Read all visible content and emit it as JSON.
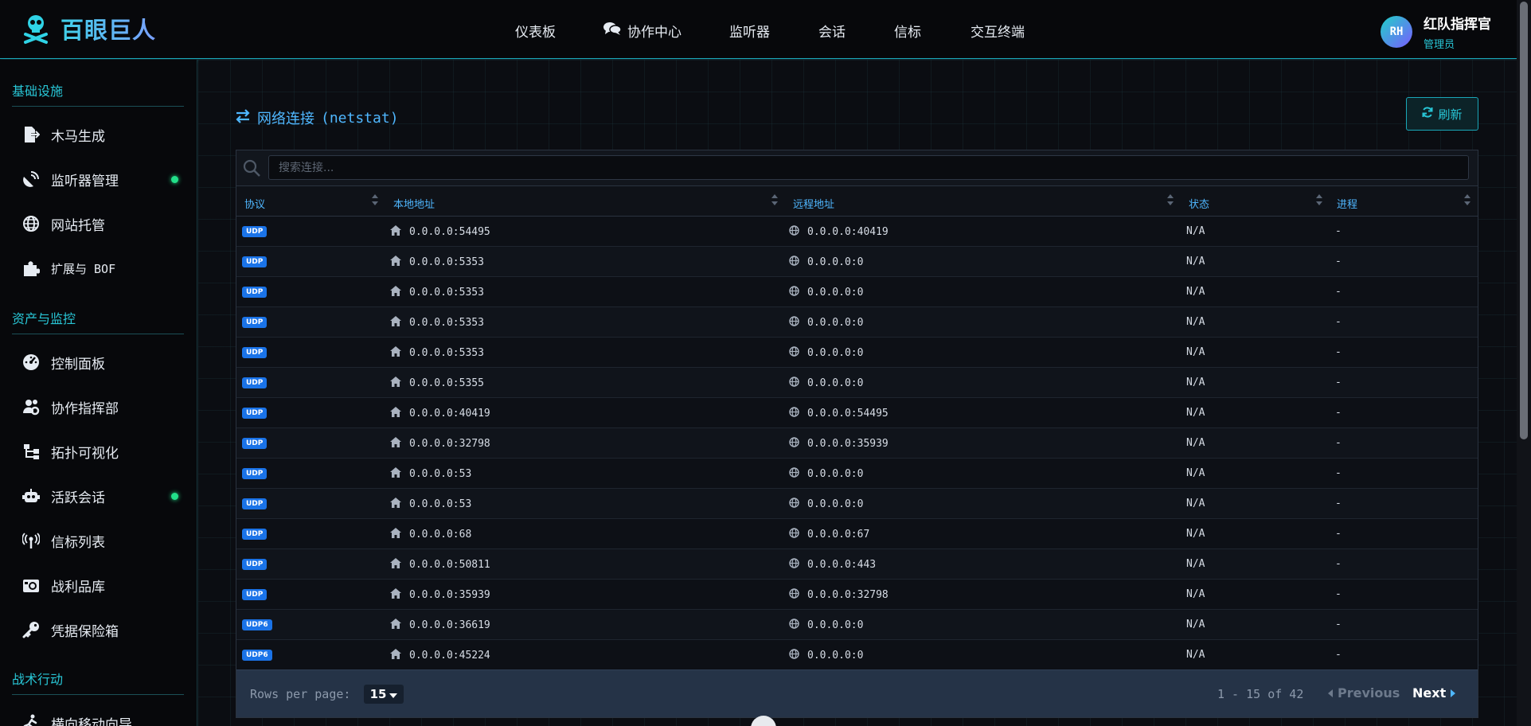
{
  "app": {
    "name": "百眼巨人"
  },
  "nav": {
    "items": [
      {
        "label": "仪表板",
        "icon": ""
      },
      {
        "label": "协作中心",
        "icon": "comments-icon"
      },
      {
        "label": "监听器",
        "icon": ""
      },
      {
        "label": "会话",
        "icon": ""
      },
      {
        "label": "信标",
        "icon": ""
      },
      {
        "label": "交互终端",
        "icon": ""
      }
    ]
  },
  "user": {
    "initials": "RH",
    "name": "红队指挥官",
    "role": "管理员"
  },
  "sidebar": {
    "sections": [
      {
        "title": "基础设施"
      },
      {
        "title": "资产与监控"
      },
      {
        "title": "战术行动"
      }
    ],
    "items": [
      {
        "label": "木马生成",
        "icon": "file-export-icon"
      },
      {
        "label": "监听器管理",
        "icon": "satellite-dish-icon",
        "status": "online"
      },
      {
        "label": "网站托管",
        "icon": "globe-icon"
      },
      {
        "label": "扩展与 BOF",
        "icon": "puzzle-piece-icon"
      },
      {
        "label": "控制面板",
        "icon": "gauge-icon"
      },
      {
        "label": "协作指挥部",
        "icon": "users-cog-icon"
      },
      {
        "label": "拓扑可视化",
        "icon": "sitemap-icon"
      },
      {
        "label": "活跃会话",
        "icon": "robot-icon",
        "status": "online"
      },
      {
        "label": "信标列表",
        "icon": "broadcast-tower-icon"
      },
      {
        "label": "战利品库",
        "icon": "camera-retro-icon"
      },
      {
        "label": "凭据保险箱",
        "icon": "key-icon"
      },
      {
        "label": "横向移动向导",
        "icon": "running-icon"
      }
    ]
  },
  "panel": {
    "title": "网络连接",
    "title_suffix": "(netstat)",
    "refresh_label": "刷新"
  },
  "search": {
    "placeholder": "搜索连接..."
  },
  "table": {
    "columns": [
      "协议",
      "本地地址",
      "远程地址",
      "状态",
      "进程"
    ],
    "rows": [
      {
        "proto": "UDP",
        "local": "0.0.0.0:54495",
        "remote": "0.0.0.0:40419",
        "state": "N/A",
        "process": "-"
      },
      {
        "proto": "UDP",
        "local": "0.0.0.0:5353",
        "remote": "0.0.0.0:0",
        "state": "N/A",
        "process": "-"
      },
      {
        "proto": "UDP",
        "local": "0.0.0.0:5353",
        "remote": "0.0.0.0:0",
        "state": "N/A",
        "process": "-"
      },
      {
        "proto": "UDP",
        "local": "0.0.0.0:5353",
        "remote": "0.0.0.0:0",
        "state": "N/A",
        "process": "-"
      },
      {
        "proto": "UDP",
        "local": "0.0.0.0:5353",
        "remote": "0.0.0.0:0",
        "state": "N/A",
        "process": "-"
      },
      {
        "proto": "UDP",
        "local": "0.0.0.0:5355",
        "remote": "0.0.0.0:0",
        "state": "N/A",
        "process": "-"
      },
      {
        "proto": "UDP",
        "local": "0.0.0.0:40419",
        "remote": "0.0.0.0:54495",
        "state": "N/A",
        "process": "-"
      },
      {
        "proto": "UDP",
        "local": "0.0.0.0:32798",
        "remote": "0.0.0.0:35939",
        "state": "N/A",
        "process": "-"
      },
      {
        "proto": "UDP",
        "local": "0.0.0.0:53",
        "remote": "0.0.0.0:0",
        "state": "N/A",
        "process": "-"
      },
      {
        "proto": "UDP",
        "local": "0.0.0.0:53",
        "remote": "0.0.0.0:0",
        "state": "N/A",
        "process": "-"
      },
      {
        "proto": "UDP",
        "local": "0.0.0.0:68",
        "remote": "0.0.0.0:67",
        "state": "N/A",
        "process": "-"
      },
      {
        "proto": "UDP",
        "local": "0.0.0.0:50811",
        "remote": "0.0.0.0:443",
        "state": "N/A",
        "process": "-"
      },
      {
        "proto": "UDP",
        "local": "0.0.0.0:35939",
        "remote": "0.0.0.0:32798",
        "state": "N/A",
        "process": "-"
      },
      {
        "proto": "UDP6",
        "local": "0.0.0.0:36619",
        "remote": "0.0.0.0:0",
        "state": "N/A",
        "process": "-"
      },
      {
        "proto": "UDP6",
        "local": "0.0.0.0:45224",
        "remote": "0.0.0.0:0",
        "state": "N/A",
        "process": "-"
      }
    ]
  },
  "pagination": {
    "rows_per_page_label": "Rows per page:",
    "rows_per_page": "15",
    "range": "1 - 15 of 42",
    "prev_label": "Previous",
    "next_label": "Next"
  },
  "colors": {
    "accent": "#28c6d6",
    "link": "#4fb7ff",
    "badge": "#1a73e8",
    "online": "#22e08a"
  }
}
